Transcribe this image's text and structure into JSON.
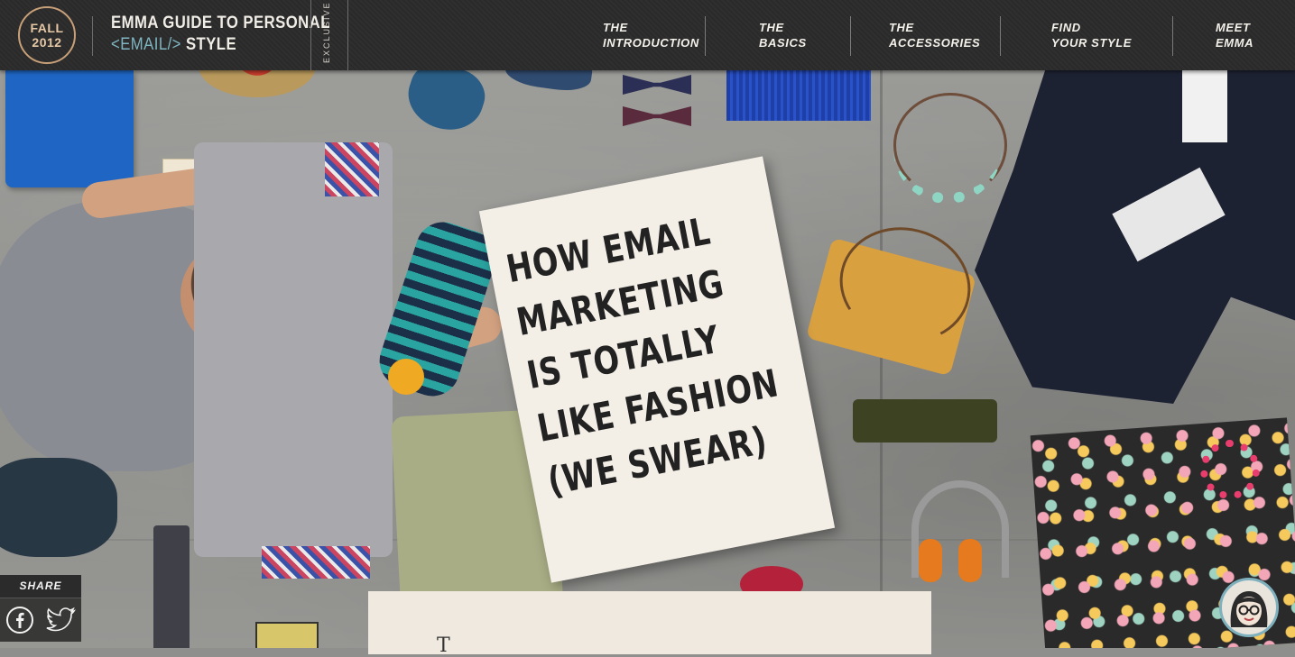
{
  "header": {
    "badge": {
      "season": "FALL",
      "year": "2012"
    },
    "brand": {
      "line1": "EMMA GUIDE TO PERSONAL",
      "email_tag": "<EMAIL/>",
      "line2_suffix": " STYLE"
    },
    "exclusive_label": "EXCLUSIVE",
    "nav": [
      {
        "label": "THE\nINTRODUCTION"
      },
      {
        "label": "THE\nBASICS"
      },
      {
        "label": "THE\nACCESSORIES"
      },
      {
        "label": "FIND\nYOUR STYLE"
      },
      {
        "label": "MEET\nEMMA"
      }
    ]
  },
  "hero": {
    "sign_lines": [
      "How email",
      "marketing",
      "is totally",
      "like fashion",
      "(we swear)"
    ]
  },
  "share": {
    "label": "SHARE",
    "icons": [
      "facebook-icon",
      "twitter-icon"
    ]
  },
  "content": {
    "dropcap": "T"
  },
  "colors": {
    "header_bg": "#2d2d2d",
    "badge_ring": "#c79f78",
    "accent_teal": "#7fb6c2",
    "sign_paper": "#f3eee6",
    "card_bg": "#f0e9df"
  }
}
